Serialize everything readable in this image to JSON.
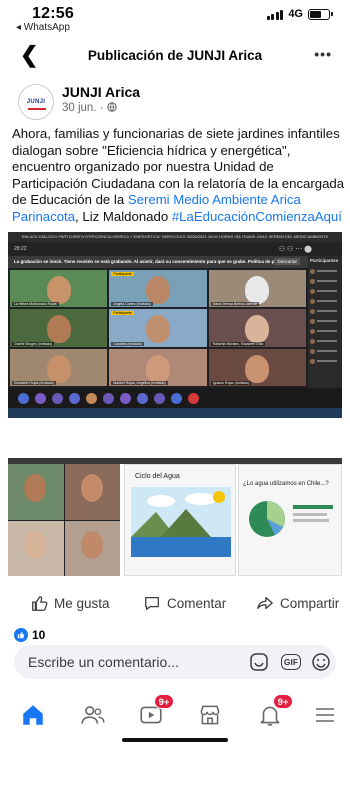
{
  "status_bar": {
    "time": "12:56",
    "back_app": "◂ WhatsApp",
    "network": "4G"
  },
  "header": {
    "back_glyph": "❮",
    "title": "Publicación de JUNJI Arica",
    "more_glyph": "•••"
  },
  "post": {
    "avatar_text": "JUNJI",
    "author": "JUNJI Arica",
    "meta": "30 jun. · ",
    "text_1": "Ahora, familias y funcionarias de siete jardines infantiles dialogan sobre  \"Eficiencia hídrica y energética\", encuentro organizado por nuestra Unidad de Participación Ciudadana con la  relatoría de la encargada de Educación de la ",
    "link_seremi": "Seremi Medio Ambiente Arica Parinacota",
    "text_2": ", Liz Maldonado ",
    "hashtag": "#LaEducaciónComienzaAquí"
  },
  "media": {
    "zoom_header": "ENLACE DIÁLOGO PARTICIPATIVO\"EFICIENCIA HÍDRICA Y ENERGÉTICA\" MIÉRCOLES 30/06/2021 16:00 HORAS VÍA TEAMS JUNJI SEREMI DEL MEDIO AMBIENTE",
    "zoom_time": "28:22",
    "recording_notice": "La grabación se inició. Tiene reunión se está grabando. Al asistir, dará su consentimiento para que se grabe. Política de privacidad",
    "dismiss": "Descartar",
    "participants_title": "Participantes",
    "tiles": [
      {
        "label": "La Hebra Maldonado Rojas",
        "tag": ""
      },
      {
        "label": "Angela Cortes (Invitado)",
        "tag": "Participante"
      },
      {
        "label": "María Teresa Berlino Allende",
        "tag": ""
      },
      {
        "label": "Giselle Bruges (Invitado)",
        "tag": ""
      },
      {
        "label": "Carolina (Invitado)",
        "tag": "Participante"
      },
      {
        "label": "Rafaella Morales, Elizabeth Díaz",
        "tag": ""
      },
      {
        "label": "Elizabeth Rojas (Invitado)",
        "tag": ""
      },
      {
        "label": "Maribel Rojas, Angelina (Invitado)",
        "tag": ""
      },
      {
        "label": "Ignacio Rojas (Invitado)",
        "tag": ""
      }
    ],
    "slide1_title": "Ciclo del Agua",
    "slide2_title": "¿Lo agua utilizamos en Chile...?"
  },
  "actions": {
    "like": "Me gusta",
    "comment": "Comentar",
    "share": "Compartir"
  },
  "reactions": {
    "count": "10"
  },
  "comment_box": {
    "placeholder": "Escribe un comentario...",
    "gif": "GIF"
  },
  "tabbar": {
    "video_badge": "9+",
    "notif_badge": "9+"
  },
  "colors": {
    "facebook_blue": "#1877f2",
    "badge_red": "#e41e3f",
    "zoom_dark": "#1d1f22"
  },
  "icons": [
    "chevron-left-icon",
    "more-icon",
    "globe-icon",
    "thumbs-up-icon",
    "comment-icon",
    "share-icon",
    "sticker-icon",
    "gif-icon",
    "emoji-icon",
    "home-icon",
    "friends-icon",
    "video-icon",
    "marketplace-icon",
    "bell-icon",
    "menu-icon"
  ]
}
